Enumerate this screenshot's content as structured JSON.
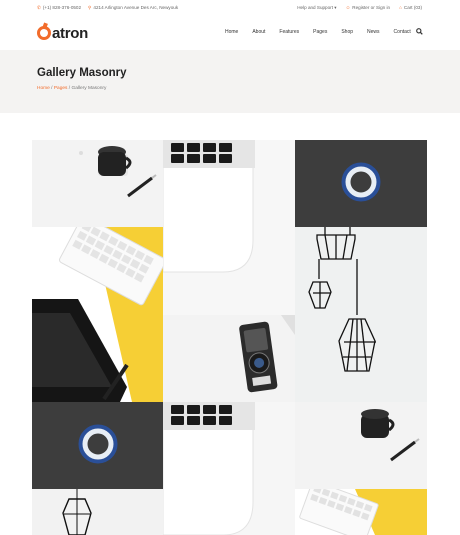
{
  "topbar": {
    "phone": "(+1) 828-376-0502",
    "address": "4214 Arlington Avenue Des Arc, Newyouk",
    "help": "Help and Support",
    "register": "Register",
    "or": "or",
    "signin": "Sign in",
    "cart": "Cart (03)"
  },
  "logo": {
    "text": "atron"
  },
  "nav": [
    "Home",
    "About",
    "Features",
    "Pages",
    "Shop",
    "News",
    "Contact"
  ],
  "page": {
    "title": "Gallery Masonry"
  },
  "breadcrumb": {
    "home": "Home",
    "pages": "Pages",
    "current": "Gallery Masonry",
    "sep": "/"
  },
  "icons": {
    "phone": "phone-icon",
    "location": "location-icon",
    "user": "user-icon",
    "cart": "cart-icon",
    "search": "search-icon"
  },
  "colors": {
    "accent": "#f26c2b",
    "yellow": "#f6cf35",
    "dark": "#333333"
  },
  "gallery": {
    "items": [
      "cup-pen",
      "keyboard-top",
      "ring-light",
      "keyboard-yellow",
      "pendant-lamps",
      "camera",
      "ring-light",
      "keyboard-bottom",
      "cup-pen",
      "pendant-lamp",
      "keyboard-yellow"
    ]
  }
}
